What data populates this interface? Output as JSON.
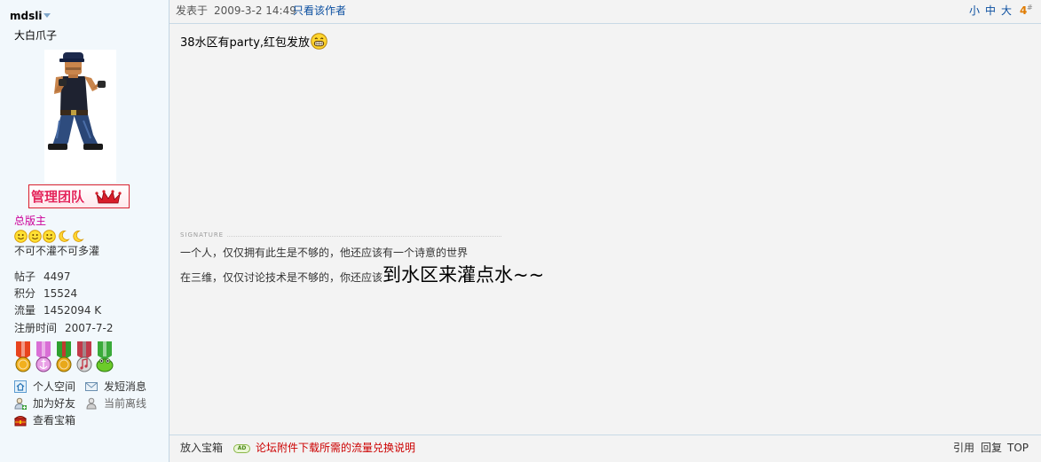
{
  "author": {
    "username": "mdsli",
    "custom_title": "大白爪子",
    "group_badge": "管理团队",
    "group_name": "总版主",
    "rank_icons": [
      "smiley-icon",
      "smiley-icon",
      "smiley-icon",
      "moon-icon",
      "moon-icon"
    ],
    "motto": "不可不灌不可多灌",
    "stats": [
      {
        "label": "帖子",
        "value": "4497"
      },
      {
        "label": "积分",
        "value": "15524"
      },
      {
        "label": "流量",
        "value": "1452094 K"
      },
      {
        "label": "注册时间",
        "value": "2007-7-2"
      }
    ],
    "medals": [
      {
        "icon": "medal-icon",
        "ribbon_color": "#E8441E",
        "medal_color": "#F2B01E"
      },
      {
        "icon": "medal-icon",
        "ribbon_color": "#D96FD6",
        "medal_color": "#E9A0E6"
      },
      {
        "icon": "medal-icon",
        "ribbon_color": "#2FA02F",
        "medal_color": "#E8A81A"
      },
      {
        "icon": "medal-icon",
        "ribbon_color": "#C23A4A",
        "medal_color": "#D8D8D8"
      },
      {
        "icon": "medal-icon",
        "ribbon_color": "#3AAA3A",
        "medal_color": "#6CCB2A"
      }
    ],
    "actions": {
      "space": {
        "icon": "home-icon",
        "label": "个人空间"
      },
      "message": {
        "icon": "mail-icon",
        "label": "发短消息"
      },
      "add_friend": {
        "icon": "add-friend-icon",
        "label": "加为好友"
      },
      "status": {
        "icon": "offline-icon",
        "label": "当前离线"
      },
      "treasure": {
        "icon": "treasure-box-icon",
        "label": "查看宝箱"
      }
    }
  },
  "post": {
    "posted_prefix": "发表于",
    "posted_time": "2009-3-2 14:49",
    "only_author_link": "只看该作者",
    "font_size_options": [
      "小",
      "中",
      "大"
    ],
    "floor": "4",
    "floor_suffix": "#",
    "body_text": "38水区有party,红包发放",
    "body_emoticon": "grin-icon",
    "signature_label": "SIGNATURE",
    "signature": {
      "line1": "一个人，仅仅拥有此生是不够的，他还应该有一个诗意的世界",
      "line2_small": "在三维，仅仅讨论技术是不够的，你还应该",
      "line2_large": "到水区来灌点水~~"
    }
  },
  "footer": {
    "add_to_box": "放入宝箱",
    "ad_badge": "AD",
    "ad_link": "论坛附件下载所需的流量兑换说明",
    "actions": [
      "引用",
      "回复",
      "TOP"
    ]
  },
  "colors": {
    "link": "#0B4FA0",
    "group_name": "#CC0099",
    "floor": "#E07B00",
    "ad_link": "#CC0000",
    "divider": "#C2D5E3",
    "sidebar_bg": "#F2F8FC",
    "main_bg": "#F3F3F3"
  }
}
